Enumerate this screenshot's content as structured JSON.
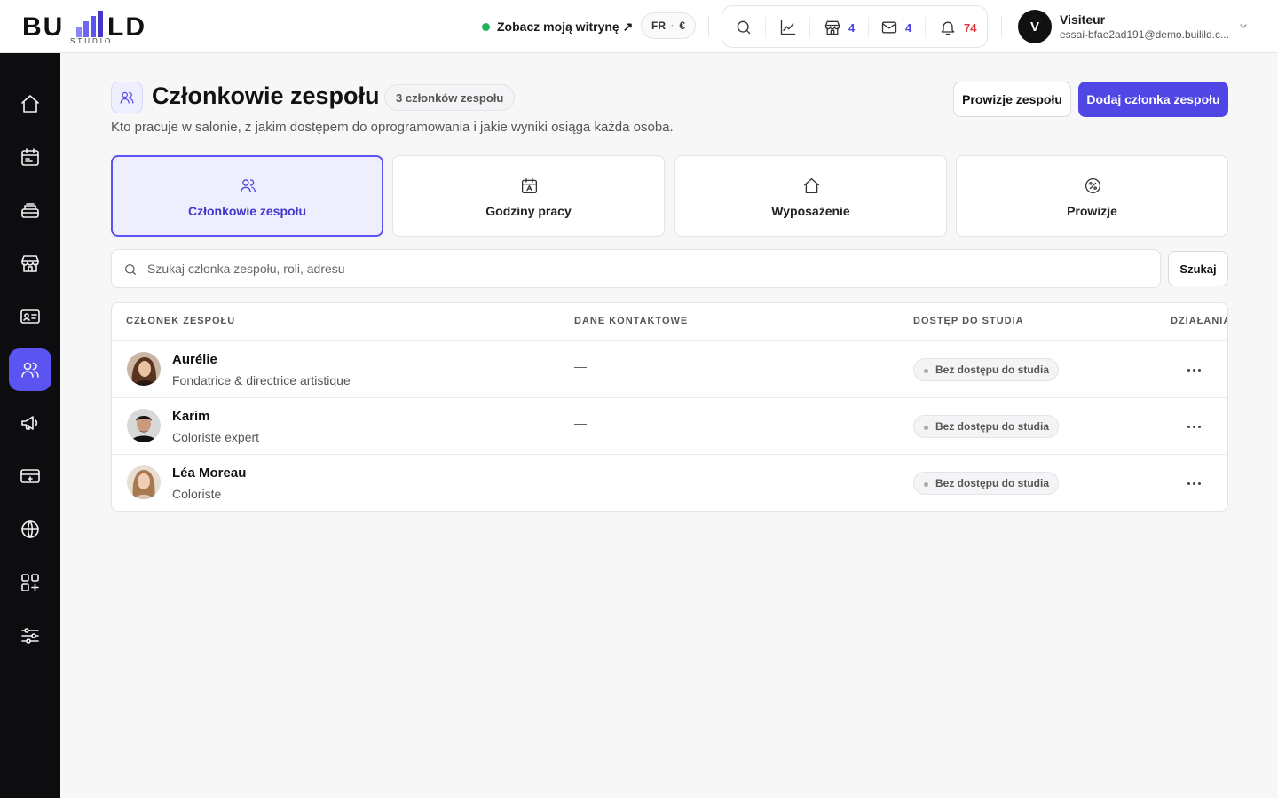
{
  "brand": {
    "logo_word": "BU LD",
    "logo_sub": "STUDIO"
  },
  "topbar": {
    "site_link": "Zobacz moją witrynę ↗",
    "lang": "FR",
    "currency": "€",
    "tools": [
      {
        "icon": "search-icon"
      },
      {
        "icon": "chart-icon"
      },
      {
        "icon": "store-icon",
        "count": "4"
      },
      {
        "icon": "mail-icon",
        "count": "4"
      },
      {
        "icon": "bell-icon",
        "count": "74"
      }
    ],
    "user": {
      "initial": "V",
      "name": "Visiteur",
      "email": "essai-bfae2ad191@demo.builild.c..."
    }
  },
  "sidebar": {
    "items": [
      {
        "icon": "home-icon"
      },
      {
        "icon": "calendar-icon"
      },
      {
        "icon": "register-icon"
      },
      {
        "icon": "store-icon"
      },
      {
        "icon": "client-card-icon"
      },
      {
        "icon": "team-icon",
        "active": true
      },
      {
        "icon": "megaphone-icon"
      },
      {
        "icon": "payment-icon"
      },
      {
        "icon": "globe-icon"
      },
      {
        "icon": "apps-icon"
      },
      {
        "icon": "settings-sliders-icon"
      }
    ]
  },
  "page": {
    "title": "Członkowie zespołu",
    "count_badge": "3 członków zespołu",
    "subtitle": "Kto pracuje w salonie, z jakim dostępem do oprogramowania i jakie wyniki osiąga każda osoba.",
    "commission_button": "Prowizje zespołu",
    "add_button": "Dodaj członka zespołu"
  },
  "tabs": [
    {
      "label": "Członkowie zespołu",
      "icon": "team-icon",
      "active": true
    },
    {
      "label": "Godziny pracy",
      "icon": "calendar-icon"
    },
    {
      "label": "Wyposażenie",
      "icon": "home-icon"
    },
    {
      "label": "Prowizje",
      "icon": "percent-icon"
    }
  ],
  "search": {
    "placeholder": "Szukaj członka zespołu, roli, adresu",
    "value": "",
    "button": "Szukaj"
  },
  "table": {
    "columns": [
      "CZŁONEK ZESPOŁU",
      "DANE KONTAKTOWE",
      "DOSTĘP DO STUDIA",
      "DZIAŁANIA"
    ],
    "rows": [
      {
        "name": "Aurélie",
        "role": "Fondatrice & directrice artistique",
        "contact": "—",
        "access": "Bez dostępu do studia"
      },
      {
        "name": "Karim",
        "role": "Coloriste expert",
        "contact": "—",
        "access": "Bez dostępu do studia"
      },
      {
        "name": "Léa Moreau",
        "role": "Coloriste",
        "contact": "—",
        "access": "Bez dostępu do studia"
      }
    ]
  },
  "colors": {
    "accent": "#4f46e5",
    "sidebar": "#0d0d10",
    "alert": "#e0323a",
    "online": "#22b05b"
  }
}
